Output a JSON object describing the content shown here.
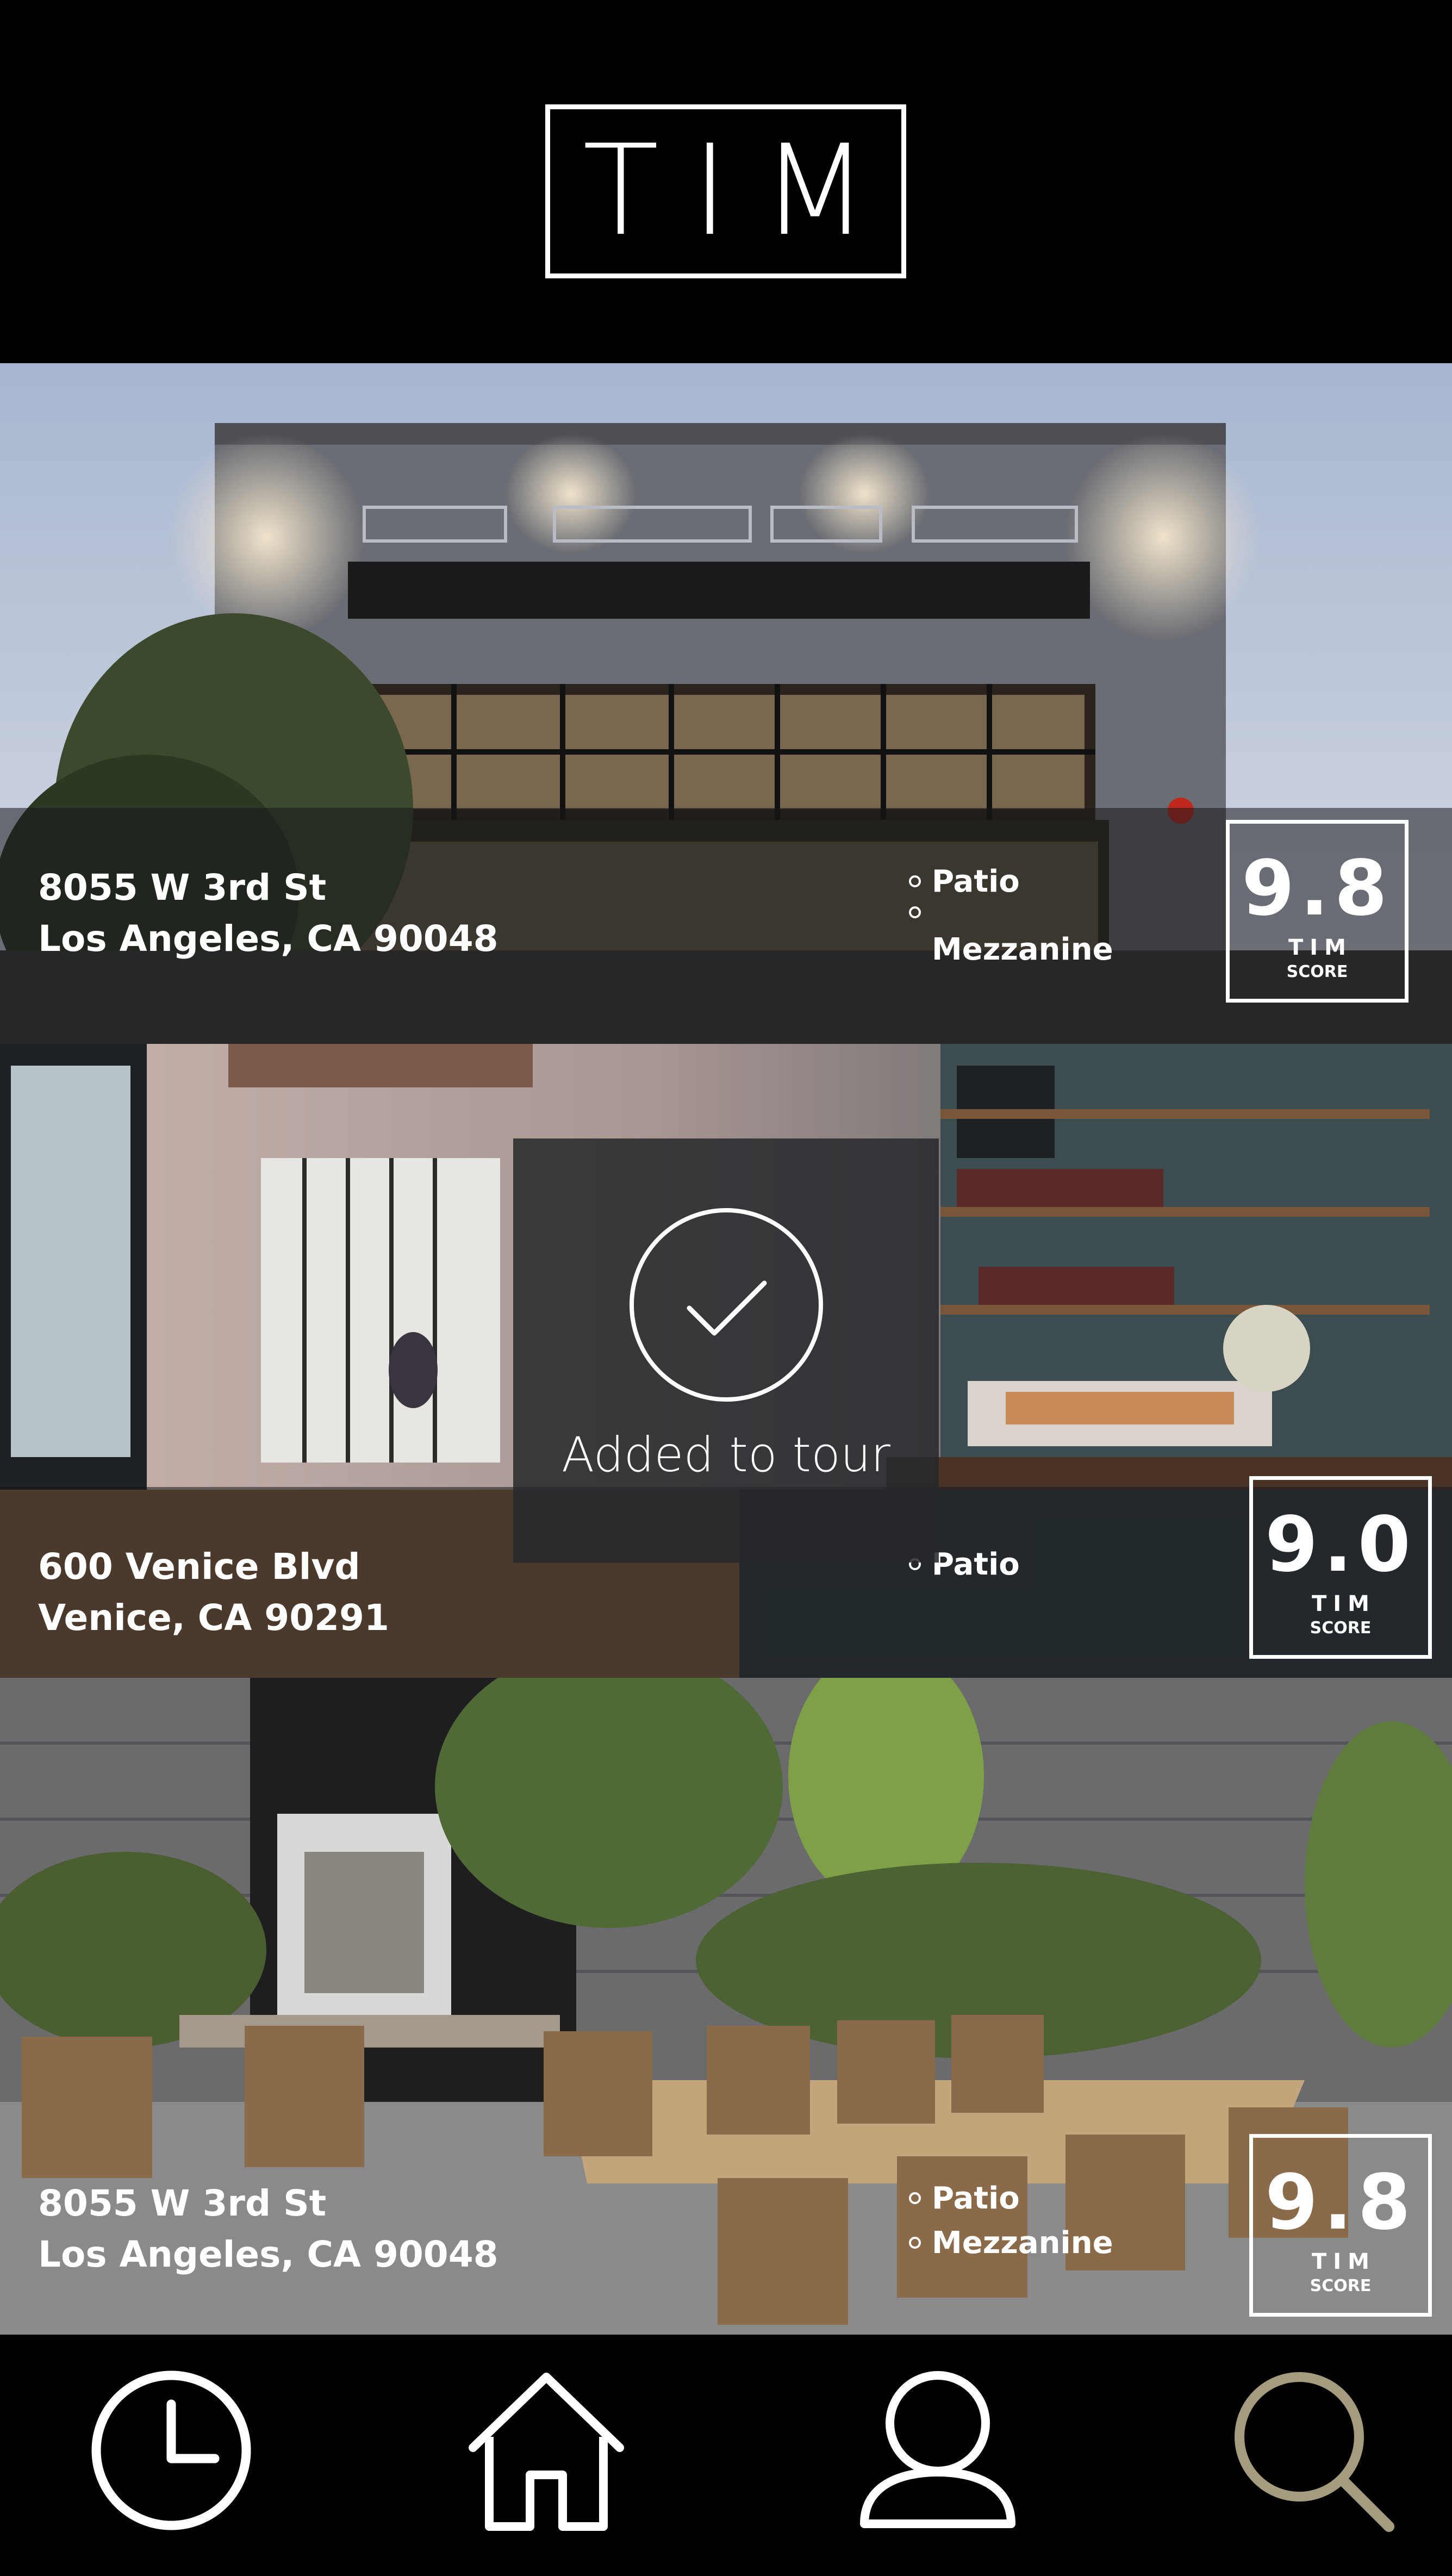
{
  "app": {
    "logo_text": "TIM"
  },
  "listings": [
    {
      "address_line1": "8055 W 3rd St",
      "address_line2": "Los Angeles, CA 90048",
      "features": [
        "Patio",
        "Mezzanine"
      ],
      "score": "9.8",
      "score_brand": "TIM",
      "score_label": "SCORE",
      "photo": "building exterior at dusk"
    },
    {
      "address_line1": "600 Venice Blvd",
      "address_line2": "Venice, CA 90291",
      "features": [
        "Patio"
      ],
      "score": "9.0",
      "score_brand": "TIM",
      "score_label": "SCORE",
      "photo": "cafe interior with shelves"
    },
    {
      "address_line1": "8055 W 3rd St",
      "address_line2": "Los Angeles, CA 90048",
      "features": [
        "Patio",
        "Mezzanine"
      ],
      "score": "9.8",
      "score_brand": "TIM",
      "score_label": "SCORE",
      "photo": "outdoor patio with wooden table"
    }
  ],
  "toast": {
    "message": "Added to tour",
    "icon": "check-circle-icon"
  },
  "nav": {
    "items": [
      {
        "icon": "clock-icon",
        "active": false
      },
      {
        "icon": "home-icon",
        "active": false
      },
      {
        "icon": "user-icon",
        "active": false
      },
      {
        "icon": "search-icon",
        "active": true
      }
    ],
    "active_color": "#a59c80",
    "inactive_color": "#ffffff"
  },
  "colors": {
    "background": "#000000",
    "overlay": "#18181a",
    "text": "#ffffff"
  }
}
